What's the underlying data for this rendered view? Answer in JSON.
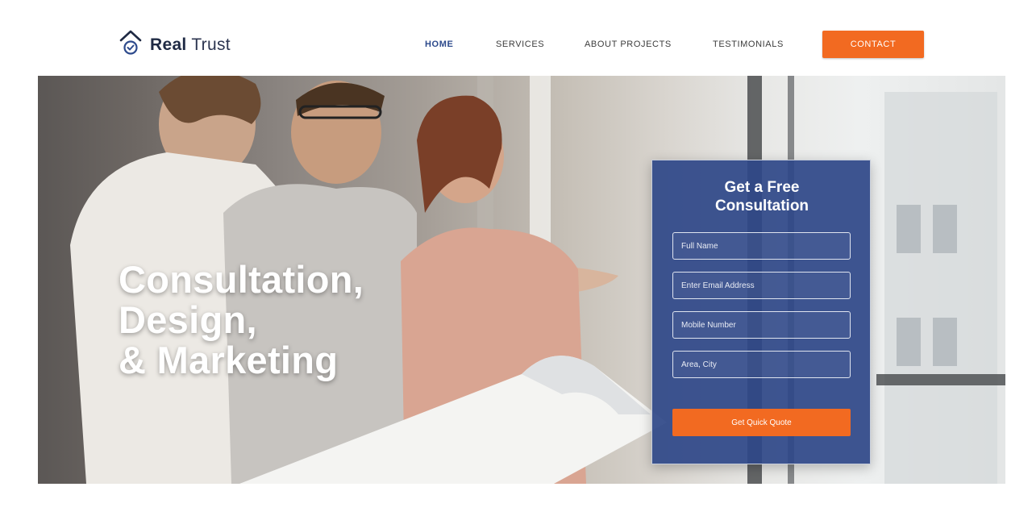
{
  "brand": {
    "name_bold": "Real",
    "name_light": "Trust",
    "logo_icon": "house-shield-icon"
  },
  "nav": {
    "items": [
      {
        "label": "HOME",
        "active": true
      },
      {
        "label": "SERVICES",
        "active": false
      },
      {
        "label": "ABOUT PROJECTS",
        "active": false
      },
      {
        "label": "TESTIMONIALS",
        "active": false
      }
    ],
    "contact_label": "CONTACT"
  },
  "hero": {
    "headline": [
      "Consultation,",
      "Design,",
      "& Marketing"
    ]
  },
  "form": {
    "title": [
      "Get a Free",
      "Consultation"
    ],
    "fields": [
      {
        "placeholder": "Full Name"
      },
      {
        "placeholder": "Enter Email Address"
      },
      {
        "placeholder": "Mobile Number"
      },
      {
        "placeholder": "Area, City"
      }
    ],
    "submit_label": "Get Quick Quote"
  },
  "colors": {
    "accent": "#f26a21",
    "brand_navy": "#2d4a8c",
    "form_bg": "#2e4688",
    "text_dark": "#1f2a44"
  }
}
